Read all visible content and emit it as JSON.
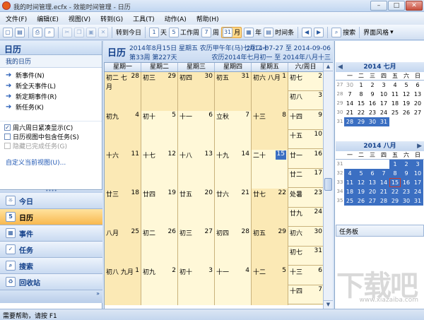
{
  "window": {
    "title": "我的时间管理.ecfx - 效能时间管理 - 日历",
    "min": "–",
    "max": "□",
    "close": "✕"
  },
  "menu": [
    "文件(F)",
    "编辑(E)",
    "视图(V)",
    "转到(G)",
    "工具(T)",
    "动作(A)",
    "帮助(H)"
  ],
  "toolbar": {
    "goto_today": "转到今日",
    "day_num": "1",
    "day": "天",
    "workweek_num": "5",
    "workweek": "工作周",
    "week_num": "7",
    "week": "周",
    "month_num": "31",
    "month": "月",
    "year": "年",
    "timeline": "时间条",
    "search": "搜索",
    "style": "界面风格"
  },
  "nav": {
    "title": "日历",
    "section": "我的日历",
    "tasks": [
      "新事件(N)",
      "新全天事件(L)",
      "新定期事件(R)",
      "新任务(K)"
    ],
    "options": [
      {
        "label": "周六周日紧凑显示(C)",
        "checked": true,
        "enabled": true
      },
      {
        "label": "日历视图中包含任务(S)",
        "checked": false,
        "enabled": true
      },
      {
        "label": "隐藏已完成任务(G)",
        "checked": false,
        "enabled": false
      }
    ],
    "custom_view": "自定义当前视图(U)...",
    "grip": "••••",
    "buttons": [
      {
        "label": "今日",
        "icon": "today-icon",
        "glyph": "☼",
        "active": false
      },
      {
        "label": "日历",
        "icon": "calendar-icon",
        "glyph": "5",
        "active": true
      },
      {
        "label": "事件",
        "icon": "event-icon",
        "glyph": "▦",
        "active": false
      },
      {
        "label": "任务",
        "icon": "task-icon",
        "glyph": "✓",
        "active": false
      },
      {
        "label": "搜索",
        "icon": "search-icon",
        "glyph": "⌕",
        "active": false
      },
      {
        "label": "回收站",
        "icon": "recycle-icon",
        "glyph": "♻",
        "active": false
      }
    ],
    "footer_chevron": "»"
  },
  "cal": {
    "view_title": "日历",
    "date_line": "2014年8月15日 星期五 农历甲午年(马)七月二十",
    "week_line": "第33周 第227天",
    "range_line": "2014-07-27 至 2014-09-06",
    "lunar_range": "农历2014年七月初一 至 2014年八月十三",
    "days_header": [
      "星期一",
      "星期二",
      "星期三",
      "星期四",
      "星期五",
      "六/周日"
    ],
    "weeks": [
      {
        "wd": [
          [
            "初二 七月",
            "28"
          ],
          [
            "初三",
            "29"
          ],
          [
            "初四",
            "30"
          ],
          [
            "初五",
            "31"
          ],
          [
            "初六  八月",
            "1"
          ]
        ],
        "sat": [
          "初七",
          "2"
        ],
        "sun": [
          "初八",
          "3"
        ]
      },
      {
        "wd": [
          [
            "初九",
            "4"
          ],
          [
            "初十",
            "5"
          ],
          [
            "十一",
            "6"
          ],
          [
            "立秋",
            "7"
          ],
          [
            "十三",
            "8"
          ]
        ],
        "sat": [
          "十四",
          "9"
        ],
        "sun": [
          "十五",
          "10"
        ]
      },
      {
        "wd": [
          [
            "十六",
            "11"
          ],
          [
            "十七",
            "12"
          ],
          [
            "十八",
            "13"
          ],
          [
            "十九",
            "14"
          ],
          [
            "二十",
            "15"
          ]
        ],
        "sat": [
          "廿一",
          "16"
        ],
        "sun": [
          "廿二",
          "17"
        ]
      },
      {
        "wd": [
          [
            "廿三",
            "18"
          ],
          [
            "廿四",
            "19"
          ],
          [
            "廿五",
            "20"
          ],
          [
            "廿六",
            "21"
          ],
          [
            "廿七",
            "22"
          ]
        ],
        "sat": [
          "处暑",
          "23"
        ],
        "sun": [
          "廿九",
          "24"
        ]
      },
      {
        "wd": [
          [
            "八月",
            "25"
          ],
          [
            "初二",
            "26"
          ],
          [
            "初三",
            "27"
          ],
          [
            "初四",
            "28"
          ],
          [
            "初五",
            "29"
          ]
        ],
        "sat": [
          "初六",
          "30"
        ],
        "sun": [
          "初七",
          "31"
        ]
      },
      {
        "wd": [
          [
            "初八  九月",
            "1"
          ],
          [
            "初九",
            "2"
          ],
          [
            "初十",
            "3"
          ],
          [
            "十一",
            "4"
          ],
          [
            "十二",
            "5"
          ]
        ],
        "sat": [
          "十三",
          "6"
        ],
        "sun": [
          "十四",
          "7"
        ]
      }
    ],
    "today": {
      "week": 2,
      "day": 4
    },
    "shaded_cols": [
      0,
      4
    ],
    "scroll_up": "▲",
    "scroll_down": "▼",
    "scroll_mid": "≡"
  },
  "mini1": {
    "title": "2014 七月",
    "prev": "◀",
    "next": "",
    "dow": [
      "一",
      "二",
      "三",
      "四",
      "五",
      "六",
      "日"
    ],
    "rows": [
      [
        "27",
        [
          "30",
          "1",
          "2",
          "3",
          "4",
          "5",
          "6"
        ]
      ],
      [
        "28",
        [
          "7",
          "8",
          "9",
          "10",
          "11",
          "12",
          "13"
        ]
      ],
      [
        "29",
        [
          "14",
          "15",
          "16",
          "17",
          "18",
          "19",
          "20"
        ]
      ],
      [
        "30",
        [
          "21",
          "22",
          "23",
          "24",
          "25",
          "26",
          "27"
        ]
      ],
      [
        "31",
        [
          "28",
          "29",
          "30",
          "31",
          "",
          "",
          ""
        ]
      ]
    ]
  },
  "mini2": {
    "title": "2014 八月",
    "prev": "",
    "next": "▶",
    "dow": [
      "一",
      "二",
      "三",
      "四",
      "五",
      "六",
      "日"
    ],
    "rows": [
      [
        "31",
        [
          "",
          "",
          "",
          "",
          "1",
          "2",
          "3"
        ]
      ],
      [
        "32",
        [
          "4",
          "5",
          "6",
          "7",
          "8",
          "9",
          "10"
        ]
      ],
      [
        "33",
        [
          "11",
          "12",
          "13",
          "14",
          "15",
          "16",
          "17"
        ]
      ],
      [
        "34",
        [
          "18",
          "19",
          "20",
          "21",
          "22",
          "23",
          "24"
        ]
      ],
      [
        "35",
        [
          "25",
          "26",
          "27",
          "28",
          "29",
          "30",
          "31"
        ]
      ]
    ]
  },
  "taskboard": "任务板",
  "status": "需要帮助，请按 F1",
  "watermark": "下载吧",
  "watermark_sub": "www.xiazaiba.com"
}
